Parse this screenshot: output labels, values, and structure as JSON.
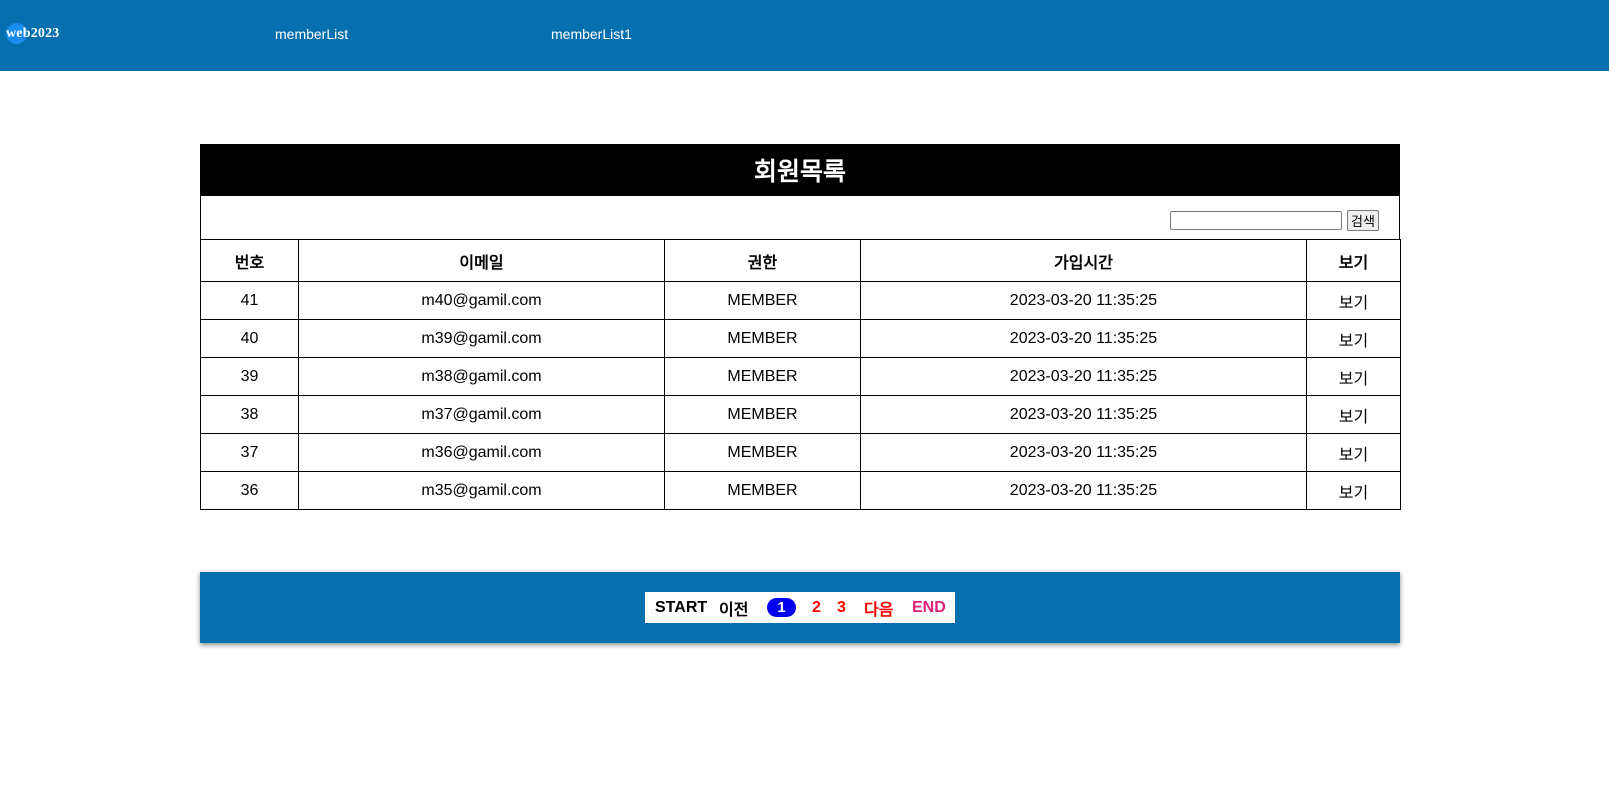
{
  "header": {
    "logo_text": "web2023",
    "nav": [
      "memberList",
      "memberList1"
    ]
  },
  "board": {
    "title": "회원목록",
    "search": {
      "value": "",
      "placeholder": "",
      "button_label": "검색"
    },
    "columns": [
      "번호",
      "이메일",
      "권한",
      "가입시간",
      "보기"
    ],
    "rows": [
      {
        "no": "41",
        "email": "m40@gamil.com",
        "role": "MEMBER",
        "joined": "2023-03-20 11:35:25",
        "view": "보기"
      },
      {
        "no": "40",
        "email": "m39@gamil.com",
        "role": "MEMBER",
        "joined": "2023-03-20 11:35:25",
        "view": "보기"
      },
      {
        "no": "39",
        "email": "m38@gamil.com",
        "role": "MEMBER",
        "joined": "2023-03-20 11:35:25",
        "view": "보기"
      },
      {
        "no": "38",
        "email": "m37@gamil.com",
        "role": "MEMBER",
        "joined": "2023-03-20 11:35:25",
        "view": "보기"
      },
      {
        "no": "37",
        "email": "m36@gamil.com",
        "role": "MEMBER",
        "joined": "2023-03-20 11:35:25",
        "view": "보기"
      },
      {
        "no": "36",
        "email": "m35@gamil.com",
        "role": "MEMBER",
        "joined": "2023-03-20 11:35:25",
        "view": "보기"
      }
    ]
  },
  "pagination": {
    "start": "START",
    "prev": "이전",
    "current": "1",
    "pages": [
      "2",
      "3"
    ],
    "next": "다음",
    "end": "END"
  },
  "colors": {
    "brand_blue": "#0670ae",
    "title_bg": "#000000",
    "current_page_bg": "#0000ee",
    "page_link": "#ff0000",
    "end_link": "#e0217a"
  }
}
